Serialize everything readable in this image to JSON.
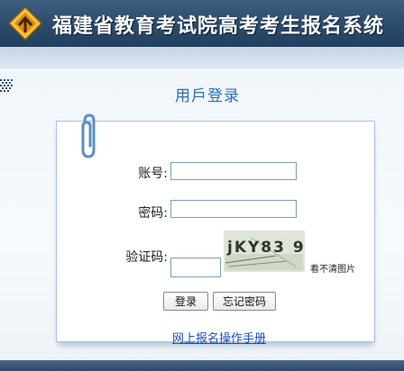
{
  "header": {
    "title": "福建省教育考试院高考考生报名系统",
    "logo_icon": "diamond-logo-icon"
  },
  "login": {
    "title": "用戶登录",
    "account_label": "账号:",
    "account_value": "",
    "password_label": "密码:",
    "password_value": "",
    "captcha_label": "验证码:",
    "captcha_value": "",
    "captcha_text": "jKY83 9",
    "captcha_unclear_link": "看不清图片",
    "login_button": "登录",
    "forgot_button": "忘记密码",
    "manual_link": "网上报名操作手册"
  },
  "colors": {
    "header_bg": "#2c4a6b",
    "title_blue": "#2a6fb3",
    "link_blue": "#1a4fc4"
  }
}
